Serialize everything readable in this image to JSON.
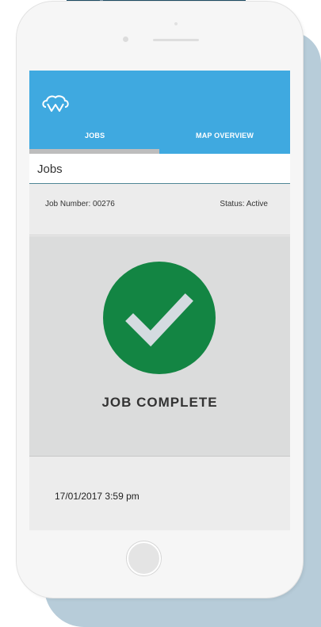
{
  "app": {
    "logo_icon": "cloud-w-logo-icon",
    "tabs": [
      {
        "label": "JOBS",
        "active": true
      },
      {
        "label": "MAP OVERVIEW",
        "active": false
      }
    ],
    "page_title": "Jobs"
  },
  "job": {
    "number_label": "Job Number: 00276",
    "status_label": "Status: Active",
    "complete_icon": "check-circle-icon",
    "complete_text": "JOB COMPLETE",
    "timestamp": "17/01/2017 3:59 pm"
  },
  "colors": {
    "appbar": "#3fa9e0",
    "success": "#138543",
    "shadow": "#b7ccd9"
  }
}
